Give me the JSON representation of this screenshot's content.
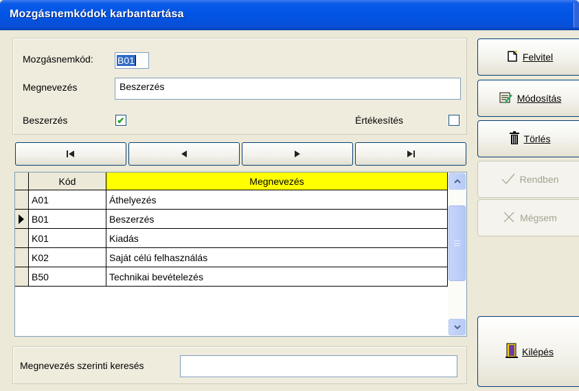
{
  "window": {
    "title": "Mozgásnemkódok karbantartása"
  },
  "form": {
    "code_label": "Mozgásnemkód:",
    "code_value": "B01",
    "name_label": "Megnevezés",
    "name_value": "Beszerzés",
    "purchase_label": "Beszerzés",
    "purchase_checked": true,
    "sales_label": "Értékesítés",
    "sales_checked": false
  },
  "navigator": {
    "first": "⏮",
    "prev": "◀",
    "next": "▶",
    "last": "⏭"
  },
  "grid": {
    "columns": [
      "Kód",
      "Megnevezés"
    ],
    "rows": [
      {
        "code": "A01",
        "name": "Áthelyezés",
        "current": false
      },
      {
        "code": "B01",
        "name": "Beszerzés",
        "current": true
      },
      {
        "code": "K01",
        "name": "Kiadás",
        "current": false
      },
      {
        "code": "K02",
        "name": "Saját célú felhasználás",
        "current": false
      },
      {
        "code": "B50",
        "name": "Technikai bevételezés",
        "current": false
      }
    ]
  },
  "search": {
    "label": "Megnevezés szerinti keresés",
    "value": ""
  },
  "buttons": {
    "new": {
      "label": "Felvitel",
      "icon": "new-document-icon"
    },
    "modify": {
      "label": "Módosítás",
      "icon": "edit-document-icon"
    },
    "delete": {
      "label": "Törlés",
      "icon": "trash-icon"
    },
    "ok": {
      "label": "Rendben",
      "icon": "check-icon"
    },
    "cancel": {
      "label": "Mégsem",
      "icon": "x-icon"
    },
    "exit": {
      "label": "Kilépés",
      "icon": "exit-door-icon"
    }
  },
  "colors": {
    "title_bar": "#0054e3",
    "header_highlight": "#ffff00",
    "selection": "#316ac5"
  }
}
